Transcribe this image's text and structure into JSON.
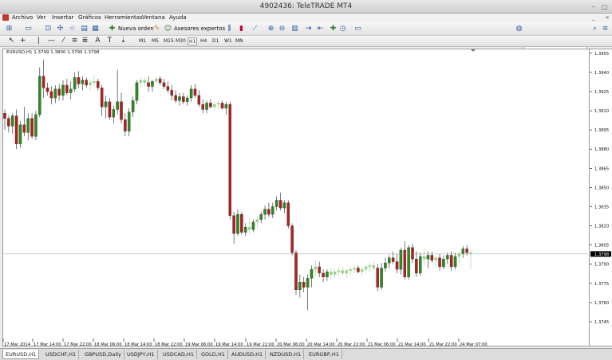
{
  "window": {
    "title": "4902436: TeleTRADE MT4"
  },
  "menu": [
    "Archivo",
    "Ver",
    "Insertar",
    "Gráficos",
    "Herramientas",
    "Ventana",
    "Ayuda"
  ],
  "toolbar": {
    "new_order": "Nueva orden",
    "expert_advisors": "Asesores expertos"
  },
  "timeframes": [
    "M1",
    "M5",
    "M15",
    "M30",
    "H1",
    "H4",
    "D1",
    "W1",
    "MN"
  ],
  "active_timeframe": "H1",
  "chart_header": {
    "symbol": "EURUSD,H1",
    "ohlc": "1.3799 1.3800 1.3790 1.3798"
  },
  "current_price": "1.3798",
  "tabs": [
    "EURUSD,H1",
    "USDCHF,H1",
    "GBPUSD,Daily",
    "USDJPY,H1",
    "USDCAD,H1",
    "GOLD,H1",
    "AUDUSD,H1",
    "NZDUSD,H1",
    "EURGBP,H1"
  ],
  "active_tab": "EURUSD,H1",
  "colors": {
    "bull": "#2e8b1f",
    "bear": "#b12020",
    "doji": "#9ad08a",
    "price_line": "#9a9a9a"
  },
  "chart_data": {
    "type": "candlestick",
    "x_ticks": [
      "17 Mar 2014",
      "17 Mar 14:00",
      "17 Mar 22:00",
      "18 Mar 06:00",
      "18 Mar 14:00",
      "18 Mar 22:00",
      "19 Mar 06:00",
      "19 Mar 14:00",
      "19 Mar 22:00",
      "20 Mar 06:00",
      "20 Mar 14:00",
      "20 Mar 22:00",
      "21 Mar 06:00",
      "21 Mar 14:00",
      "21 Mar 22:00",
      "24 Mar 07:00"
    ],
    "y_ticks": [
      "1.3955",
      "1.3940",
      "1.3925",
      "1.3910",
      "1.3895",
      "1.3880",
      "1.3865",
      "1.3850",
      "1.3835",
      "1.3820",
      "1.3805",
      "1.3790",
      "1.3775",
      "1.3760",
      "1.3745"
    ],
    "ylim": [
      1.374,
      1.3958
    ],
    "candles": [
      [
        1.3908,
        1.3911,
        1.3895,
        1.3904
      ],
      [
        1.3904,
        1.3906,
        1.3893,
        1.3898
      ],
      [
        1.3898,
        1.3908,
        1.3892,
        1.3906
      ],
      [
        1.3906,
        1.3911,
        1.388,
        1.3884
      ],
      [
        1.3884,
        1.3902,
        1.3881,
        1.3899
      ],
      [
        1.3899,
        1.3913,
        1.389,
        1.3893
      ],
      [
        1.3893,
        1.3908,
        1.3887,
        1.3904
      ],
      [
        1.3904,
        1.3908,
        1.3888,
        1.389
      ],
      [
        1.389,
        1.391,
        1.3887,
        1.3907
      ],
      [
        1.3907,
        1.3944,
        1.3905,
        1.3937
      ],
      [
        1.3937,
        1.395,
        1.392,
        1.3928
      ],
      [
        1.3928,
        1.3932,
        1.3922,
        1.3925
      ],
      [
        1.3925,
        1.3929,
        1.3915,
        1.392
      ],
      [
        1.392,
        1.393,
        1.3916,
        1.3927
      ],
      [
        1.3927,
        1.3931,
        1.3918,
        1.3922
      ],
      [
        1.3922,
        1.3934,
        1.3918,
        1.393
      ],
      [
        1.393,
        1.3935,
        1.3922,
        1.3924
      ],
      [
        1.3924,
        1.3933,
        1.3919,
        1.3927
      ],
      [
        1.3927,
        1.394,
        1.3925,
        1.3936
      ],
      [
        1.3936,
        1.3941,
        1.3928,
        1.3931
      ],
      [
        1.3931,
        1.3937,
        1.3926,
        1.3934
      ],
      [
        1.3934,
        1.3936,
        1.3928,
        1.393
      ],
      [
        1.393,
        1.3934,
        1.3926,
        1.3932
      ],
      [
        1.3932,
        1.3938,
        1.3929,
        1.3933
      ],
      [
        1.3933,
        1.3935,
        1.3926,
        1.3928
      ],
      [
        1.3928,
        1.393,
        1.3906,
        1.3913
      ],
      [
        1.3913,
        1.3922,
        1.3904,
        1.3917
      ],
      [
        1.3917,
        1.392,
        1.3903,
        1.3905
      ],
      [
        1.3905,
        1.3914,
        1.39,
        1.3911
      ],
      [
        1.3911,
        1.3942,
        1.3907,
        1.3917
      ],
      [
        1.3917,
        1.3924,
        1.39,
        1.3903
      ],
      [
        1.3903,
        1.3908,
        1.389,
        1.3894
      ],
      [
        1.3894,
        1.3912,
        1.389,
        1.3909
      ],
      [
        1.3909,
        1.3921,
        1.3905,
        1.3918
      ],
      [
        1.3918,
        1.3934,
        1.3915,
        1.3932
      ],
      [
        1.3932,
        1.3936,
        1.3928,
        1.3934
      ],
      [
        1.3934,
        1.3936,
        1.3929,
        1.3932
      ],
      [
        1.3932,
        1.3937,
        1.3925,
        1.3929
      ],
      [
        1.3929,
        1.3934,
        1.3925,
        1.3933
      ],
      [
        1.3933,
        1.3936,
        1.3931,
        1.3935
      ],
      [
        1.3935,
        1.3937,
        1.393,
        1.3932
      ],
      [
        1.3932,
        1.3935,
        1.3927,
        1.3929
      ],
      [
        1.3929,
        1.3933,
        1.3924,
        1.3926
      ],
      [
        1.3926,
        1.393,
        1.3918,
        1.3922
      ],
      [
        1.3922,
        1.3926,
        1.3916,
        1.3918
      ],
      [
        1.3918,
        1.3924,
        1.3914,
        1.3921
      ],
      [
        1.3921,
        1.3924,
        1.3915,
        1.3917
      ],
      [
        1.3917,
        1.3922,
        1.3914,
        1.392
      ],
      [
        1.392,
        1.393,
        1.3917,
        1.3927
      ],
      [
        1.3927,
        1.3931,
        1.392,
        1.3922
      ],
      [
        1.3922,
        1.3926,
        1.3913,
        1.3915
      ],
      [
        1.3915,
        1.3919,
        1.3908,
        1.3911
      ],
      [
        1.3911,
        1.3918,
        1.3908,
        1.3916
      ],
      [
        1.3916,
        1.3919,
        1.3912,
        1.3913
      ],
      [
        1.3913,
        1.3917,
        1.391,
        1.3915
      ],
      [
        1.3915,
        1.3918,
        1.3911,
        1.3916
      ],
      [
        1.3916,
        1.3918,
        1.3911,
        1.3912
      ],
      [
        1.3912,
        1.3917,
        1.3907,
        1.3915
      ],
      [
        1.3915,
        1.3917,
        1.3825,
        1.3828
      ],
      [
        1.3828,
        1.3831,
        1.3806,
        1.3814
      ],
      [
        1.3814,
        1.3833,
        1.3812,
        1.3829
      ],
      [
        1.3829,
        1.3831,
        1.3813,
        1.3815
      ],
      [
        1.3815,
        1.3822,
        1.3812,
        1.3819
      ],
      [
        1.3819,
        1.3826,
        1.3814,
        1.3817
      ],
      [
        1.3817,
        1.3825,
        1.3815,
        1.3823
      ],
      [
        1.3823,
        1.3828,
        1.3818,
        1.3825
      ],
      [
        1.3825,
        1.3831,
        1.3822,
        1.3829
      ],
      [
        1.3829,
        1.3836,
        1.3825,
        1.3833
      ],
      [
        1.3833,
        1.3838,
        1.3827,
        1.3829
      ],
      [
        1.3829,
        1.3838,
        1.3826,
        1.3835
      ],
      [
        1.3835,
        1.3843,
        1.3832,
        1.384
      ],
      [
        1.384,
        1.3846,
        1.3832,
        1.3834
      ],
      [
        1.3834,
        1.384,
        1.383,
        1.3838
      ],
      [
        1.3838,
        1.384,
        1.3818,
        1.382
      ],
      [
        1.382,
        1.3822,
        1.3797,
        1.3799
      ],
      [
        1.3799,
        1.3801,
        1.3766,
        1.377
      ],
      [
        1.377,
        1.3782,
        1.3764,
        1.3776
      ],
      [
        1.3776,
        1.378,
        1.3768,
        1.3772
      ],
      [
        1.3772,
        1.3782,
        1.3754,
        1.3779
      ],
      [
        1.3779,
        1.3789,
        1.3772,
        1.3786
      ],
      [
        1.3786,
        1.3793,
        1.3781,
        1.3788
      ],
      [
        1.3788,
        1.3792,
        1.378,
        1.3783
      ],
      [
        1.3783,
        1.3786,
        1.3776,
        1.378
      ],
      [
        1.378,
        1.3786,
        1.3777,
        1.3784
      ],
      [
        1.3784,
        1.3787,
        1.3779,
        1.3782
      ],
      [
        1.3782,
        1.3786,
        1.3779,
        1.3784
      ],
      [
        1.3784,
        1.3788,
        1.378,
        1.3785
      ],
      [
        1.3785,
        1.3788,
        1.3781,
        1.3783
      ],
      [
        1.3783,
        1.3786,
        1.3779,
        1.3785
      ],
      [
        1.3785,
        1.3788,
        1.3782,
        1.3786
      ],
      [
        1.3786,
        1.3789,
        1.3783,
        1.3787
      ],
      [
        1.3787,
        1.3789,
        1.3783,
        1.3784
      ],
      [
        1.3784,
        1.3788,
        1.3781,
        1.3786
      ],
      [
        1.3786,
        1.379,
        1.3783,
        1.3788
      ],
      [
        1.3788,
        1.3791,
        1.3784,
        1.3789
      ],
      [
        1.3789,
        1.3792,
        1.3785,
        1.3787
      ],
      [
        1.3787,
        1.379,
        1.3769,
        1.3772
      ],
      [
        1.3772,
        1.3791,
        1.377,
        1.3787
      ],
      [
        1.3787,
        1.3795,
        1.3784,
        1.3791
      ],
      [
        1.3791,
        1.3797,
        1.3787,
        1.3795
      ],
      [
        1.3795,
        1.38,
        1.379,
        1.3792
      ],
      [
        1.3792,
        1.3798,
        1.3783,
        1.3786
      ],
      [
        1.3786,
        1.3803,
        1.3782,
        1.3801
      ],
      [
        1.3801,
        1.3808,
        1.3778,
        1.378
      ],
      [
        1.378,
        1.3805,
        1.3778,
        1.3803
      ],
      [
        1.3803,
        1.3806,
        1.3791,
        1.3794
      ],
      [
        1.3794,
        1.38,
        1.378,
        1.3783
      ],
      [
        1.3783,
        1.3799,
        1.3781,
        1.3796
      ],
      [
        1.3796,
        1.3802,
        1.3789,
        1.3794
      ],
      [
        1.3794,
        1.38,
        1.3787,
        1.3797
      ],
      [
        1.3797,
        1.38,
        1.3791,
        1.3793
      ],
      [
        1.3793,
        1.3797,
        1.3788,
        1.3795
      ],
      [
        1.3795,
        1.3798,
        1.3785,
        1.3788
      ],
      [
        1.3788,
        1.3797,
        1.3786,
        1.3794
      ],
      [
        1.3794,
        1.3799,
        1.379,
        1.3797
      ],
      [
        1.3797,
        1.38,
        1.3785,
        1.3788
      ],
      [
        1.3788,
        1.3799,
        1.3786,
        1.3796
      ],
      [
        1.3796,
        1.38,
        1.3791,
        1.3798
      ],
      [
        1.3798,
        1.3804,
        1.3795,
        1.3802
      ],
      [
        1.3802,
        1.3805,
        1.3797,
        1.3799
      ],
      [
        1.3799,
        1.3801,
        1.3786,
        1.3798
      ]
    ]
  }
}
